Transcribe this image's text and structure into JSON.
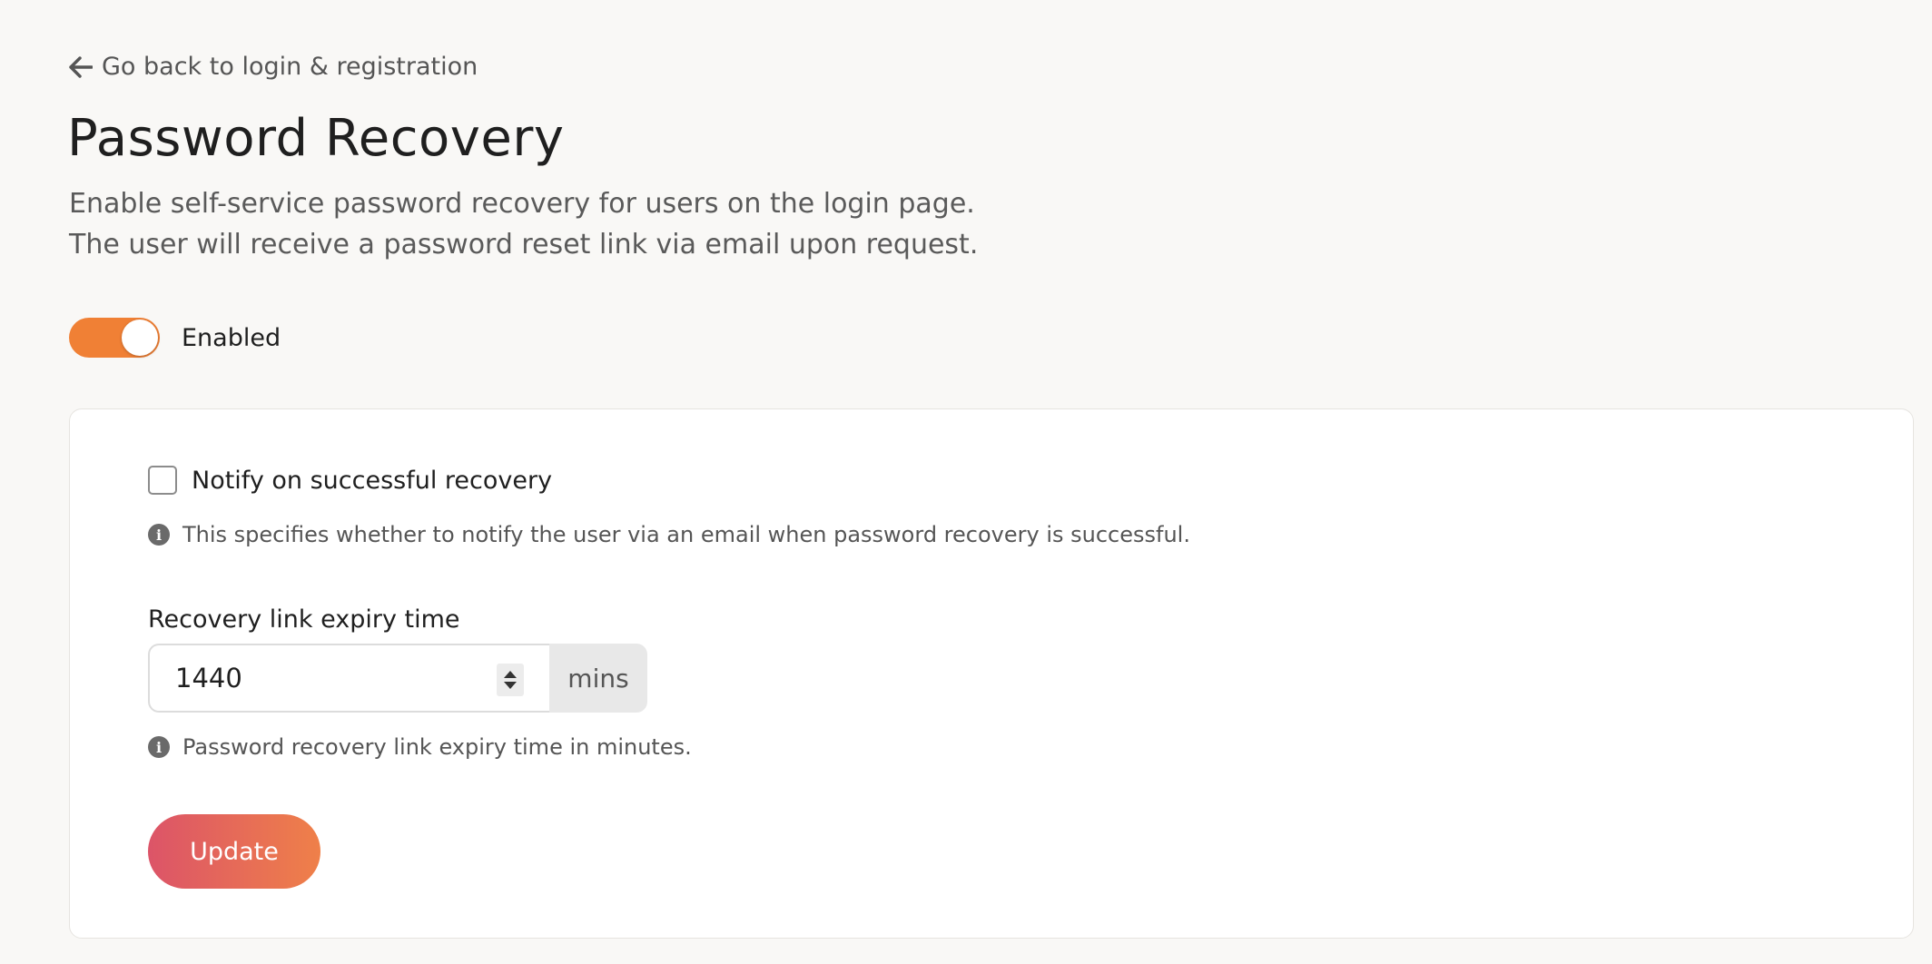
{
  "back_link": {
    "label": "Go back to login & registration",
    "icon": "arrow-left-icon"
  },
  "header": {
    "title": "Password Recovery",
    "description_line_1": "Enable self-service password recovery for users on the login page.",
    "description_line_2": "The user will receive a password reset link via email upon request."
  },
  "toggle": {
    "label": "Enabled",
    "state": "on",
    "color": "#f08035"
  },
  "settings": {
    "notify_checkbox": {
      "label": "Notify on successful recovery",
      "checked": false,
      "help": "This specifies whether to notify the user via an email when password recovery is successful."
    },
    "expiry": {
      "label": "Recovery link expiry time",
      "value": "1440",
      "unit": "mins",
      "help": "Password recovery link expiry time in minutes."
    },
    "update_label": "Update"
  },
  "colors": {
    "button_gradient_start": "#dc5468",
    "button_gradient_end": "#ef8049",
    "background": "#f9f8f6"
  }
}
